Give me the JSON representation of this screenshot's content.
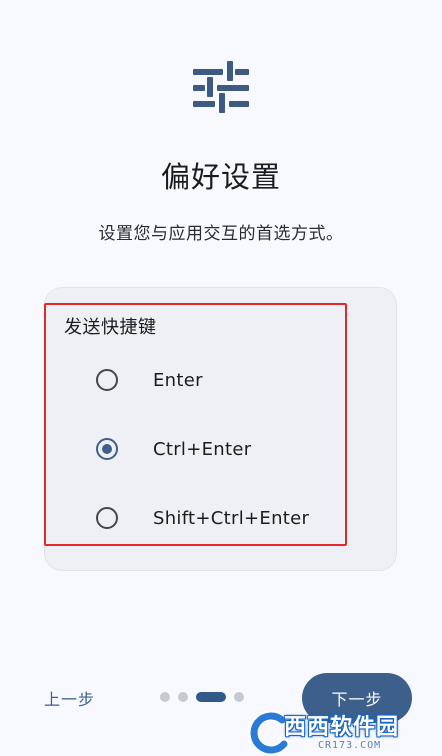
{
  "header": {
    "icon": "tune-sliders-icon",
    "title": "偏好设置",
    "subtitle": "设置您与应用交互的首选方式。"
  },
  "settings": {
    "group_label": "发送快捷键",
    "options": [
      {
        "label": "Enter",
        "selected": false
      },
      {
        "label": "Ctrl+Enter",
        "selected": true
      },
      {
        "label": "Shift+Ctrl+Enter",
        "selected": false
      }
    ]
  },
  "footer": {
    "back_label": "上一步",
    "next_label": "下一步",
    "pages": 4,
    "current_page": 3
  },
  "watermark": {
    "text": "西西软件园",
    "url": "CR173.COM"
  },
  "colors": {
    "accent": "#3d5f8c",
    "background": "#f8f9ff",
    "card": "#eff0f5",
    "highlight": "#e32a2a"
  }
}
